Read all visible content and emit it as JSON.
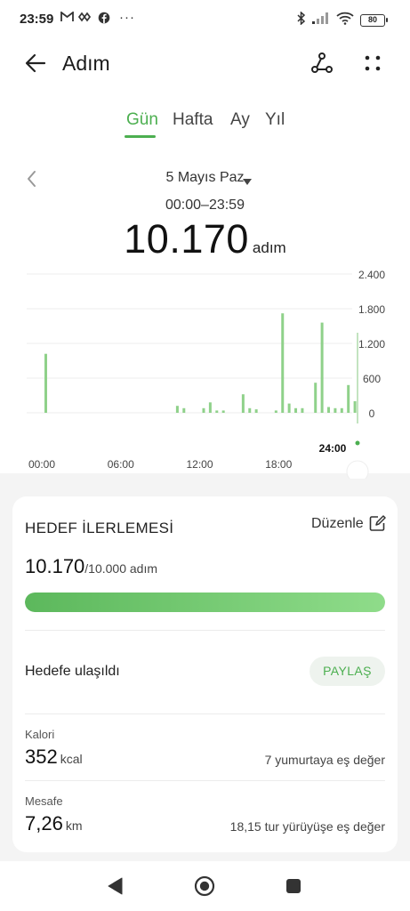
{
  "status_bar": {
    "time": "23:59",
    "battery": "80",
    "more": "···"
  },
  "header": {
    "title": "Adım"
  },
  "tabs": [
    {
      "label": "Gün",
      "active": true
    },
    {
      "label": "Hafta",
      "active": false
    },
    {
      "label": "Ay",
      "active": false
    },
    {
      "label": "Yıl",
      "active": false
    }
  ],
  "date": {
    "label": "5 Mayıs Paz",
    "range": "00:00–23:59"
  },
  "summary": {
    "steps": "10.170",
    "unit": "adım"
  },
  "chart_data": {
    "type": "bar",
    "x_range": [
      "00:00",
      "24:00"
    ],
    "x_ticks": [
      "00:00",
      "06:00",
      "12:00",
      "18:00"
    ],
    "current_label": "24:00",
    "y_ticks": [
      "2.400",
      "1.800",
      "1.200",
      "600",
      "0"
    ],
    "ylim": [
      0,
      2400
    ],
    "grid": true,
    "color": "#8fd18a",
    "points": [
      {
        "h": 1.25,
        "v": 1020
      },
      {
        "h": 11.25,
        "v": 120
      },
      {
        "h": 11.75,
        "v": 80
      },
      {
        "h": 13.25,
        "v": 80
      },
      {
        "h": 13.75,
        "v": 180
      },
      {
        "h": 14.25,
        "v": 40
      },
      {
        "h": 14.75,
        "v": 40
      },
      {
        "h": 16.25,
        "v": 320
      },
      {
        "h": 16.75,
        "v": 80
      },
      {
        "h": 17.25,
        "v": 60
      },
      {
        "h": 18.75,
        "v": 40
      },
      {
        "h": 19.25,
        "v": 1720
      },
      {
        "h": 19.75,
        "v": 160
      },
      {
        "h": 20.25,
        "v": 80
      },
      {
        "h": 20.75,
        "v": 80
      },
      {
        "h": 21.75,
        "v": 520
      },
      {
        "h": 22.25,
        "v": 1560
      },
      {
        "h": 22.75,
        "v": 100
      },
      {
        "h": 23.25,
        "v": 80
      },
      {
        "h": 23.75,
        "v": 80
      },
      {
        "h": 24.25,
        "v": 480
      },
      {
        "h": 24.75,
        "v": 200
      }
    ]
  },
  "goal": {
    "title": "HEDEF İLERLEMESİ",
    "edit_label": "Düzenle",
    "current": "10.170",
    "target_text": "/10.000 adım",
    "progress": 1.0,
    "reached_text": "Hedefe ulaşıldı",
    "share_label": "PAYLAŞ"
  },
  "calories": {
    "label": "Kalori",
    "value": "352",
    "unit": "kcal",
    "equiv": "7 yumurtaya eş değer"
  },
  "distance": {
    "label": "Mesafe",
    "value": "7,26",
    "unit": "km",
    "equiv": "18,15 tur yürüyüşe eş değer"
  },
  "colors": {
    "accent": "#4caf50",
    "bar": "#8fd18a",
    "progress_start": "#5cb85c",
    "progress_end": "#8fdc8a"
  },
  "icons": [
    "back-arrow-icon",
    "route-share-icon",
    "more-dots-icon",
    "date-prev-icon",
    "dropdown-caret-icon",
    "edit-icon",
    "nav-back-icon",
    "nav-home-icon",
    "nav-recents-icon"
  ]
}
